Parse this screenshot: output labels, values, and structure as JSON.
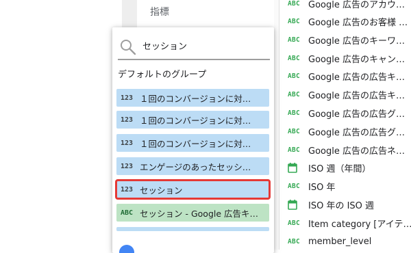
{
  "background": {
    "label": "指標"
  },
  "dropdown": {
    "search": {
      "value": "セッション",
      "icon": "search-icon"
    },
    "group_title": "デフォルトのグループ",
    "options": [
      {
        "type": "123",
        "label": "１回のコンバージョンに対…",
        "kind": "number"
      },
      {
        "type": "123",
        "label": "１回のコンバージョンに対…",
        "kind": "number"
      },
      {
        "type": "123",
        "label": "１回のコンバージョンに対…",
        "kind": "number"
      },
      {
        "type": "123",
        "label": "エンゲージのあったセッシ…",
        "kind": "number"
      },
      {
        "type": "123",
        "label": "セッション",
        "kind": "number",
        "selected": true
      },
      {
        "type": "ABC",
        "label": "セッション - Google 広告キ…",
        "kind": "text"
      }
    ],
    "accent_color": "#bcdcf5",
    "text_color_bg": "#bde3c4",
    "highlight_color": "#e53935"
  },
  "field_list": {
    "items": [
      {
        "type": "ABC",
        "label": "Google 広告のアカウ…"
      },
      {
        "type": "ABC",
        "label": "Google 広告のお客様 …"
      },
      {
        "type": "ABC",
        "label": "Google 広告のキーワ…"
      },
      {
        "type": "ABC",
        "label": "Google 広告のキャン…"
      },
      {
        "type": "ABC",
        "label": "Google 広告の広告キ…"
      },
      {
        "type": "ABC",
        "label": "Google 広告の広告キ…"
      },
      {
        "type": "ABC",
        "label": "Google 広告の広告グ…"
      },
      {
        "type": "ABC",
        "label": "Google 広告の広告グ…"
      },
      {
        "type": "ABC",
        "label": "Google 広告の広告ネ…"
      },
      {
        "type": "calendar",
        "label": "ISO 週（年間）"
      },
      {
        "type": "ABC",
        "label": "ISO 年"
      },
      {
        "type": "calendar",
        "label": "ISO 年の ISO 週"
      },
      {
        "type": "ABC",
        "label": "Item category [アイテ…"
      },
      {
        "type": "ABC",
        "label": "member_level"
      }
    ],
    "type_color": "#34a853"
  }
}
